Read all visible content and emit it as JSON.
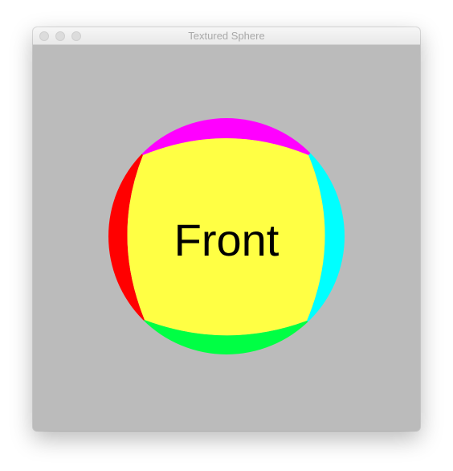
{
  "window": {
    "title": "Textured Sphere"
  },
  "scene": {
    "background_color": "#bbbbbb",
    "sphere": {
      "front_label": "Front",
      "colors": {
        "front": "#ffff44",
        "top": "#ff00ff",
        "right": "#00ffff",
        "bottom": "#00ff44",
        "left": "#ff0000"
      }
    }
  }
}
